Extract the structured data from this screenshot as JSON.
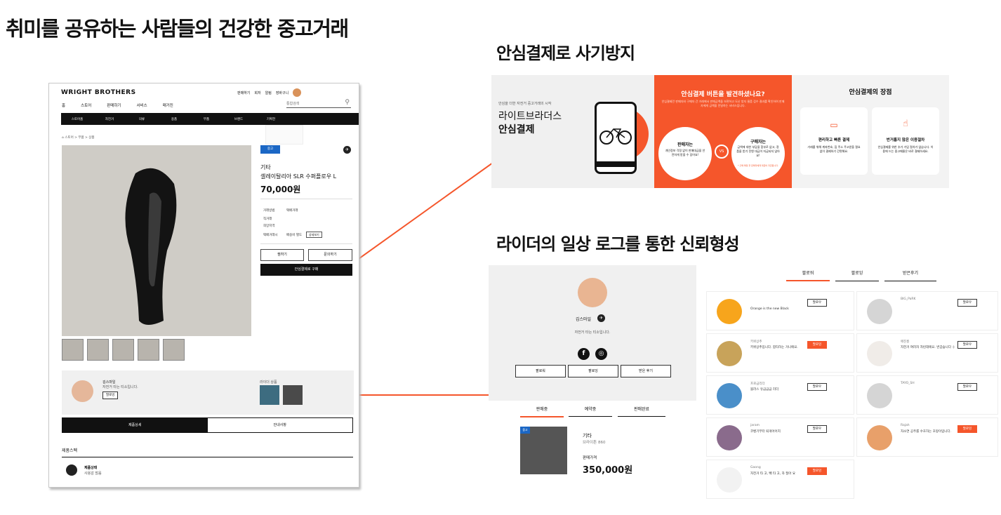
{
  "headline": "취미를 공유하는 사람들의 건강한 중고거래",
  "section_pay_title": "안심결제로 사기방지",
  "section_log_title": "라이더의 일상 로그를 통한 신뢰형성",
  "colors": {
    "accent": "#f5562b",
    "blue_tag": "#1b67c5",
    "dark": "#111111"
  },
  "product_page": {
    "logo": "WRIGHT BROTHERS",
    "top_links": [
      "판매하기",
      "회저",
      "알림",
      "장바구니"
    ],
    "main_nav": [
      "홈",
      "스토어",
      "판매하기",
      "서비스",
      "매거진"
    ],
    "search_placeholder": "통합검색",
    "category_bar": [
      "스토어홈",
      "자전거",
      "의류",
      "용품",
      "부품",
      "브랜드",
      "기획전"
    ],
    "breadcrumb": "스토어 > 부품 > 상품",
    "tag": "중고",
    "category": "기타",
    "product_name": "셀레이탈리아 SLR 수퍼플로우 L",
    "price": "70,000원",
    "info": [
      {
        "label": "거래방법",
        "value": "택배거래"
      },
      {
        "label": "직거래",
        "value": ""
      },
      {
        "label": "희망지역",
        "value": ""
      },
      {
        "label": "택배거래시",
        "value": "배송비 별도"
      }
    ],
    "detail_button": "상세보기",
    "like_button": "찜하기",
    "ask_button": "문의하기",
    "safe_pay_button": "안심결제로 구매",
    "seller_name": "김스마일",
    "seller_msg": "자전거 타는 티소입니다.",
    "follow_button": "팔로잉",
    "rider_items_label": "라이더 상품",
    "tab_detail": "제품상세",
    "tab_guide": "안내사항",
    "spec_title": "제품스펙",
    "spec_item_title": "제품상태",
    "spec_item_value": "사용감 많음"
  },
  "pay_panel": {
    "intro_small": "안심을 더한 자전거 중고거래의 시작",
    "brand_line1": "라이트브라더스",
    "brand_line2": "안심결제",
    "orange_title": "안심결제 버튼을 발견하셨나요?",
    "orange_sub": "안심결제란 판매자와 구매자 간 거래에서 판매금액을 보관하고 도난 방지 물품 검수 결과를 확인하여 판매자에게 금액을 전달하는 서비스입니다.",
    "seller_title": "판매자는",
    "seller_text": "개인정보 걱정 없이 판매대금을 안전하게 받을 수 있어요!",
    "vs": "VS",
    "buyer_title": "구매자는",
    "buyer_text": "금액에 대한 부담을 함부로 없고, 정품을 받기 전엔 대금이 지급되지 않아요!",
    "buyer_note": "* 구매 확정 후 판매자에게 대금이 지급됩니다.",
    "merits_title": "안심결제의 장점",
    "merit1_title": "편리하고 빠른 결제",
    "merit1_text": "거래를 위해 계좌번호, 집 주소 주고받을 필요 없이 결제하기 간편해요.",
    "merit2_title": "번거롭지 않은 이용절차",
    "merit2_text": "안심결제를 위한 추가 가입 절차가 없습니다. 이용에 드는 중고매물은 바로 결제하세요."
  },
  "profile_panel": {
    "name": "김스마일",
    "intro": "자전거 타는 티소입니다.",
    "btn_follower": "팔로워",
    "btn_following": "팔로잉",
    "btn_review": "받은 후기",
    "sale_tabs": [
      "판매중",
      "예약중",
      "판매완료"
    ],
    "item_tag": "중고",
    "item_category": "기타",
    "item_name": "브라이튼 860",
    "item_price_label": "판매가격",
    "item_price": "350,000원"
  },
  "follow_panel": {
    "tabs": [
      "팔로워",
      "팔로잉",
      "받은후기"
    ],
    "follow_label": "팔로우",
    "following_label": "팔로잉",
    "users": [
      {
        "name": "",
        "msg": "Orange is the new Black",
        "state": "팔로우"
      },
      {
        "name": "BIG_PaRK",
        "msg": "",
        "state": "팔로우"
      },
      {
        "name": "키위상추",
        "msg": "키위상추입니다. 함타하는 거니에요.",
        "state": "팔로잉"
      },
      {
        "name": "애진홍",
        "msg": "자전거 여러차 자린데에요. 번갑습니다 :)",
        "state": "팔로우"
      },
      {
        "name": "프로금리더",
        "msg": "블라스 유금금금 리더",
        "state": "팔로우"
      },
      {
        "name": "TAYO_SH",
        "msg": "",
        "state": "팔로우"
      },
      {
        "name": "jaram",
        "msg": "코벤기부터 퇴게어어지",
        "state": "팔로우"
      },
      {
        "name": "Rajah",
        "msg": "자소연 공주를 수호하는 호랑이입니다.",
        "state": "팔로잉"
      },
      {
        "name": "Gaong",
        "msg": "자전거 타 고, 빽 타 고, 차 질아 요",
        "state": "팔로잉"
      }
    ]
  }
}
